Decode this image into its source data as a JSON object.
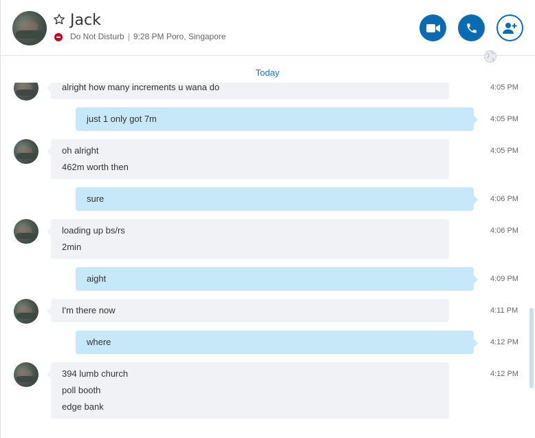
{
  "contact": {
    "name": "Jack",
    "status": "Do Not Disturb",
    "local_time": "9:28 PM Poro, Singapore"
  },
  "icons": {
    "favorite": "star-outline-icon",
    "status": "do-not-disturb-icon",
    "video": "video-camera-icon",
    "call": "phone-icon",
    "add": "add-person-icon",
    "globe": "globe-icon"
  },
  "colors": {
    "accent": "#0a6bb3",
    "dnd": "#d0021b",
    "incoming_bubble": "#f1f2f5",
    "outgoing_bubble": "#c7e8f8",
    "date_label": "#0a78c8"
  },
  "date_separator": "Today",
  "messages": [
    {
      "direction": "in",
      "lines": [
        "alright how many increments u wana do"
      ],
      "time": "4:05 PM"
    },
    {
      "direction": "out",
      "lines": [
        "just 1 only got 7m"
      ],
      "time": "4:05 PM"
    },
    {
      "direction": "in",
      "lines": [
        "oh alright",
        "462m worth then"
      ],
      "time": "4:05 PM"
    },
    {
      "direction": "out",
      "lines": [
        "sure"
      ],
      "time": "4:06 PM"
    },
    {
      "direction": "in",
      "lines": [
        "loading up bs/rs",
        "2min"
      ],
      "time": "4:06 PM"
    },
    {
      "direction": "out",
      "lines": [
        "aight"
      ],
      "time": "4:09 PM"
    },
    {
      "direction": "in",
      "lines": [
        "I'm there now"
      ],
      "time": "4:11 PM"
    },
    {
      "direction": "out",
      "lines": [
        "where"
      ],
      "time": "4:12 PM"
    },
    {
      "direction": "in",
      "lines": [
        "394 lumb church",
        "poll booth",
        "edge bank"
      ],
      "time": "4:12 PM"
    }
  ]
}
